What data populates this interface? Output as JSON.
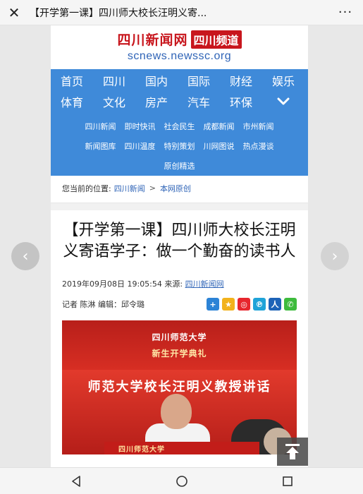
{
  "topbar": {
    "title": "【开学第一课】四川师大校长汪明义寄...",
    "close_icon": "close-icon",
    "more_icon": "more-dots-icon"
  },
  "site": {
    "logo_main": "四川新闻网",
    "logo_badge": "四川频道",
    "logo_url": "scnews.newssc.org",
    "brand_color": "#c8161d",
    "nav_color": "#3f8ad9"
  },
  "nav": {
    "row1": [
      "首页",
      "四川",
      "国内",
      "国际",
      "财经",
      "娱乐"
    ],
    "row2": [
      "体育",
      "文化",
      "房产",
      "汽车",
      "环保"
    ],
    "expand_icon": "chevron-down-icon",
    "sub_row1": [
      "四川新闻",
      "即时快讯",
      "社会民生",
      "成都新闻",
      "市州新闻"
    ],
    "sub_row2": [
      "新闻图库",
      "四川温度",
      "特别策划",
      "川网图说",
      "热点漫谈"
    ],
    "sub_row3": [
      "原创精选"
    ]
  },
  "breadcrumb": {
    "prefix": "您当前的位置:",
    "level1": "四川新闻",
    "separator": ">",
    "level2": "本网原创"
  },
  "article": {
    "headline": "【开学第一课】四川师大校长汪明义寄语学子：做一个勤奋的读书人",
    "datetime": "2019年09月08日 19:05:54",
    "source_prefix": "来源:",
    "source": "四川新闻网",
    "byline": "记者 陈淋 编辑：邱令璐",
    "share_icons": [
      "plus-share-icon",
      "qzone-icon",
      "weibo-icon",
      "tencent-weibo-icon",
      "renren-icon",
      "wechat-icon"
    ]
  },
  "photo": {
    "banner_line1": "四川师范大学",
    "banner_line2": "新生开学典礼",
    "slogan": "师范大学校长汪明义教授讲话",
    "podium_text": "四川师范大学"
  },
  "controls": {
    "prev_icon": "chevron-left-icon",
    "next_icon": "chevron-right-icon",
    "back_to_top_icon": "back-to-top-icon"
  },
  "system_nav": {
    "back_icon": "triangle-back-icon",
    "home_icon": "circle-home-icon",
    "recents_icon": "square-recents-icon"
  }
}
